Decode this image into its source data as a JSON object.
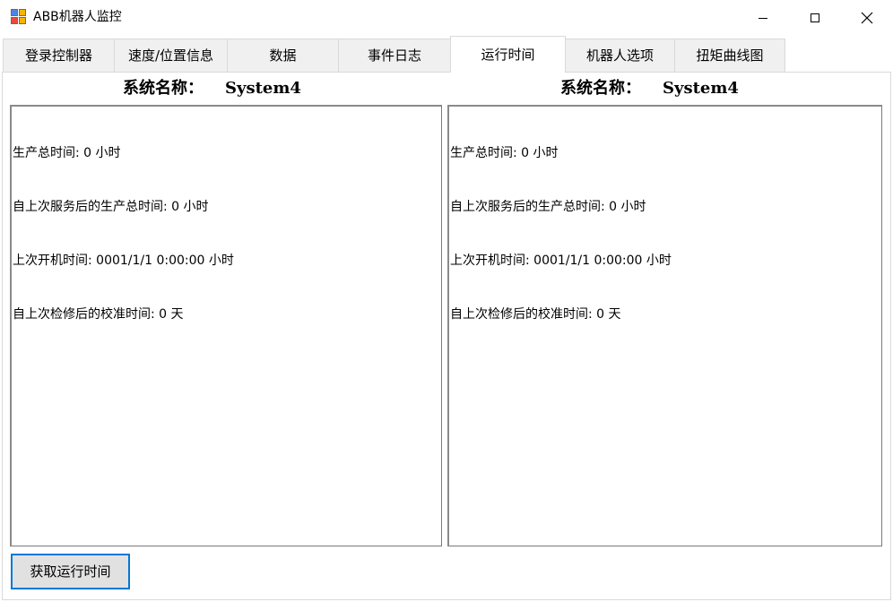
{
  "window": {
    "title": "ABB机器人监控"
  },
  "tabs": [
    {
      "label": "登录控制器"
    },
    {
      "label": "速度/位置信息"
    },
    {
      "label": "数据"
    },
    {
      "label": "事件日志"
    },
    {
      "label": "运行时间"
    },
    {
      "label": "机器人选项"
    },
    {
      "label": "扭矩曲线图"
    }
  ],
  "active_tab": "运行时间",
  "left_panel": {
    "system_label": "系统名称：",
    "system_value": "System4",
    "lines": [
      "生产总时间: 0 小时",
      "自上次服务后的生产总时间: 0 小时",
      "上次开机时间: 0001/1/1 0:00:00 小时",
      "自上次检修后的校准时间: 0 天"
    ]
  },
  "right_panel": {
    "system_label": "系统名称：",
    "system_value": "System4",
    "lines": [
      "生产总时间: 0 小时",
      "自上次服务后的生产总时间: 0 小时",
      "上次开机时间: 0001/1/1 0:00:00 小时",
      "自上次检修后的校准时间: 0 天"
    ]
  },
  "actions": {
    "get_runtime_label": "获取运行时间"
  }
}
